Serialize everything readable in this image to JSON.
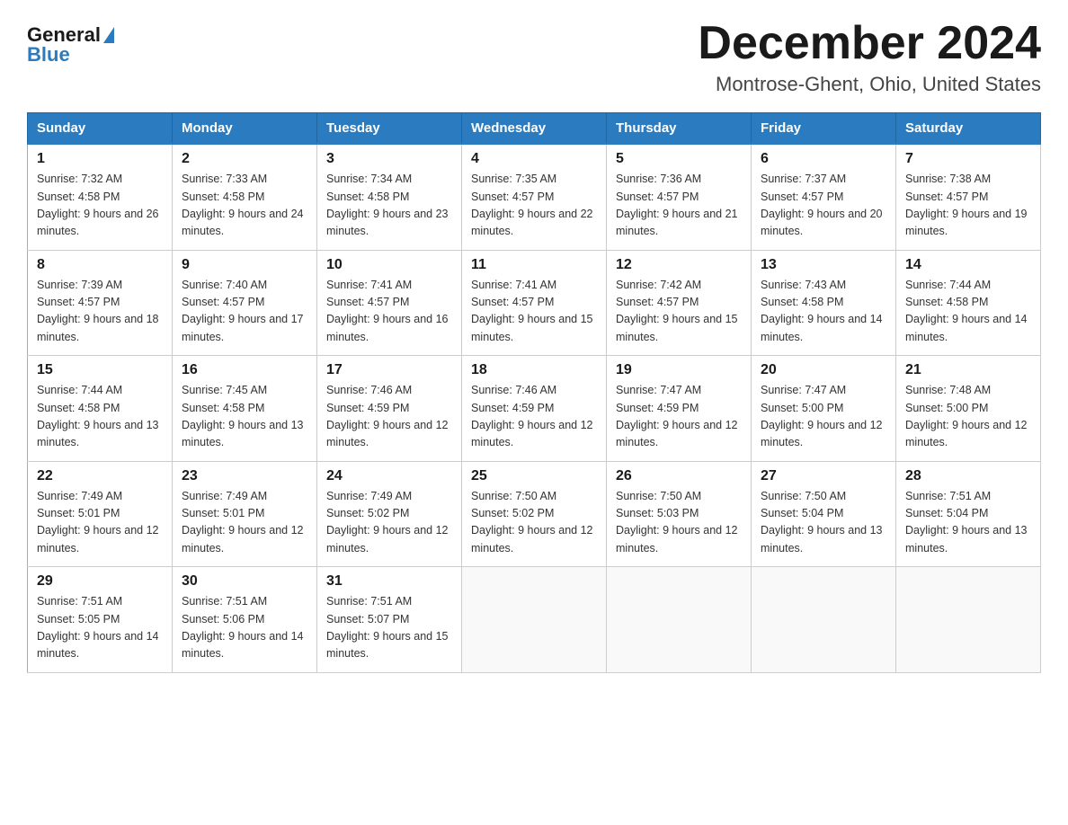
{
  "header": {
    "logo_general": "General",
    "logo_blue": "Blue",
    "title": "December 2024",
    "subtitle": "Montrose-Ghent, Ohio, United States"
  },
  "days_of_week": [
    "Sunday",
    "Monday",
    "Tuesday",
    "Wednesday",
    "Thursday",
    "Friday",
    "Saturday"
  ],
  "weeks": [
    [
      {
        "day": "1",
        "sunrise": "7:32 AM",
        "sunset": "4:58 PM",
        "daylight": "9 hours and 26 minutes."
      },
      {
        "day": "2",
        "sunrise": "7:33 AM",
        "sunset": "4:58 PM",
        "daylight": "9 hours and 24 minutes."
      },
      {
        "day": "3",
        "sunrise": "7:34 AM",
        "sunset": "4:58 PM",
        "daylight": "9 hours and 23 minutes."
      },
      {
        "day": "4",
        "sunrise": "7:35 AM",
        "sunset": "4:57 PM",
        "daylight": "9 hours and 22 minutes."
      },
      {
        "day": "5",
        "sunrise": "7:36 AM",
        "sunset": "4:57 PM",
        "daylight": "9 hours and 21 minutes."
      },
      {
        "day": "6",
        "sunrise": "7:37 AM",
        "sunset": "4:57 PM",
        "daylight": "9 hours and 20 minutes."
      },
      {
        "day": "7",
        "sunrise": "7:38 AM",
        "sunset": "4:57 PM",
        "daylight": "9 hours and 19 minutes."
      }
    ],
    [
      {
        "day": "8",
        "sunrise": "7:39 AM",
        "sunset": "4:57 PM",
        "daylight": "9 hours and 18 minutes."
      },
      {
        "day": "9",
        "sunrise": "7:40 AM",
        "sunset": "4:57 PM",
        "daylight": "9 hours and 17 minutes."
      },
      {
        "day": "10",
        "sunrise": "7:41 AM",
        "sunset": "4:57 PM",
        "daylight": "9 hours and 16 minutes."
      },
      {
        "day": "11",
        "sunrise": "7:41 AM",
        "sunset": "4:57 PM",
        "daylight": "9 hours and 15 minutes."
      },
      {
        "day": "12",
        "sunrise": "7:42 AM",
        "sunset": "4:57 PM",
        "daylight": "9 hours and 15 minutes."
      },
      {
        "day": "13",
        "sunrise": "7:43 AM",
        "sunset": "4:58 PM",
        "daylight": "9 hours and 14 minutes."
      },
      {
        "day": "14",
        "sunrise": "7:44 AM",
        "sunset": "4:58 PM",
        "daylight": "9 hours and 14 minutes."
      }
    ],
    [
      {
        "day": "15",
        "sunrise": "7:44 AM",
        "sunset": "4:58 PM",
        "daylight": "9 hours and 13 minutes."
      },
      {
        "day": "16",
        "sunrise": "7:45 AM",
        "sunset": "4:58 PM",
        "daylight": "9 hours and 13 minutes."
      },
      {
        "day": "17",
        "sunrise": "7:46 AM",
        "sunset": "4:59 PM",
        "daylight": "9 hours and 12 minutes."
      },
      {
        "day": "18",
        "sunrise": "7:46 AM",
        "sunset": "4:59 PM",
        "daylight": "9 hours and 12 minutes."
      },
      {
        "day": "19",
        "sunrise": "7:47 AM",
        "sunset": "4:59 PM",
        "daylight": "9 hours and 12 minutes."
      },
      {
        "day": "20",
        "sunrise": "7:47 AM",
        "sunset": "5:00 PM",
        "daylight": "9 hours and 12 minutes."
      },
      {
        "day": "21",
        "sunrise": "7:48 AM",
        "sunset": "5:00 PM",
        "daylight": "9 hours and 12 minutes."
      }
    ],
    [
      {
        "day": "22",
        "sunrise": "7:49 AM",
        "sunset": "5:01 PM",
        "daylight": "9 hours and 12 minutes."
      },
      {
        "day": "23",
        "sunrise": "7:49 AM",
        "sunset": "5:01 PM",
        "daylight": "9 hours and 12 minutes."
      },
      {
        "day": "24",
        "sunrise": "7:49 AM",
        "sunset": "5:02 PM",
        "daylight": "9 hours and 12 minutes."
      },
      {
        "day": "25",
        "sunrise": "7:50 AM",
        "sunset": "5:02 PM",
        "daylight": "9 hours and 12 minutes."
      },
      {
        "day": "26",
        "sunrise": "7:50 AM",
        "sunset": "5:03 PM",
        "daylight": "9 hours and 12 minutes."
      },
      {
        "day": "27",
        "sunrise": "7:50 AM",
        "sunset": "5:04 PM",
        "daylight": "9 hours and 13 minutes."
      },
      {
        "day": "28",
        "sunrise": "7:51 AM",
        "sunset": "5:04 PM",
        "daylight": "9 hours and 13 minutes."
      }
    ],
    [
      {
        "day": "29",
        "sunrise": "7:51 AM",
        "sunset": "5:05 PM",
        "daylight": "9 hours and 14 minutes."
      },
      {
        "day": "30",
        "sunrise": "7:51 AM",
        "sunset": "5:06 PM",
        "daylight": "9 hours and 14 minutes."
      },
      {
        "day": "31",
        "sunrise": "7:51 AM",
        "sunset": "5:07 PM",
        "daylight": "9 hours and 15 minutes."
      },
      null,
      null,
      null,
      null
    ]
  ]
}
